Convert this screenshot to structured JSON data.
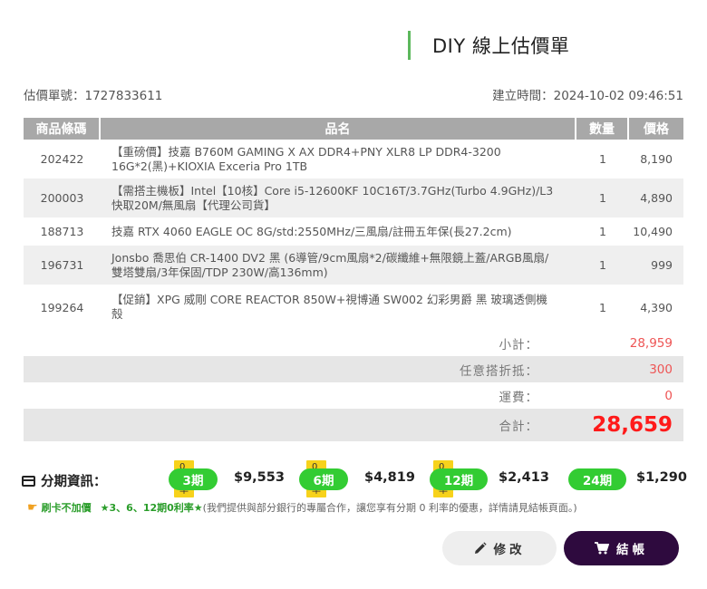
{
  "header": {
    "title": "DIY 線上估價單"
  },
  "meta": {
    "quote_no": "估價單號：1727833611",
    "created": "建立時間：2024-10-02 09:46:51"
  },
  "table": {
    "headers": [
      "商品條碼",
      "品名",
      "數量",
      "價格"
    ],
    "rows": [
      {
        "code": "202422",
        "name": "【重磅價】技嘉 B760M GAMING X AX DDR4+PNY XLR8 LP DDR4-3200 16G*2(黑)+KIOXIA Exceria Pro 1TB",
        "qty": "1",
        "price": "8,190"
      },
      {
        "code": "200003",
        "name": "【需搭主機板】Intel【10核】Core i5-12600KF 10C16T/3.7GHz(Turbo 4.9GHz)/L3快取20M/無風扇【代理公司貨】",
        "qty": "1",
        "price": "4,890"
      },
      {
        "code": "188713",
        "name": "技嘉 RTX 4060 EAGLE OC 8G/std:2550MHz/三風扇/註冊五年保(長27.2cm)",
        "qty": "1",
        "price": "10,490"
      },
      {
        "code": "196731",
        "name": "Jonsbo 喬思伯 CR-1400 DV2 黑 (6導管/9cm風扇*2/碳纖維+無限鏡上蓋/ARGB風扇/雙塔雙扇/3年保固/TDP 230W/高136mm)",
        "qty": "1",
        "price": "999"
      },
      {
        "code": "199264",
        "name": "【促銷】XPG 威剛 CORE REACTOR 850W+視博通 SW002 幻彩男爵 黑 玻璃透側機殼",
        "qty": "1",
        "price": "4,390"
      }
    ]
  },
  "summary": {
    "subtotal_label": "小計：",
    "subtotal": "28,959",
    "discount_label": "任意搭折抵：",
    "discount": "300",
    "shipping_label": "運費：",
    "shipping": "0",
    "total_label": "合計：",
    "total": "28,659"
  },
  "installments": {
    "label": "分期資訊：",
    "zero_rate": "0利率",
    "plans": [
      {
        "period": "3期",
        "amount": "$9,553",
        "zero": true
      },
      {
        "period": "6期",
        "amount": "$4,819",
        "zero": true
      },
      {
        "period": "12期",
        "amount": "$2,413",
        "zero": true
      },
      {
        "period": "24期",
        "amount": "$1,290",
        "zero": false
      }
    ]
  },
  "note": {
    "tag1": "刷卡不加價",
    "tag2": "★3、6、12期0利率★",
    "text": "(我們提供與部分銀行的專屬合作，讓您享有分期 0 利率的優惠，詳情請見結帳頁面。)"
  },
  "actions": {
    "edit": "修改",
    "checkout": "結帳"
  },
  "colors": {
    "accent": "#5cb85c",
    "green": "#33cc33",
    "total_red": "#ff1a1a",
    "checkout_bg": "#2e0a3e"
  },
  "icons": {
    "title_bar": "green-vertical-bar",
    "card": "credit-card-icon",
    "hand": "pointing-hand-icon",
    "edit": "pencil-icon",
    "checkout": "cart-icon"
  }
}
